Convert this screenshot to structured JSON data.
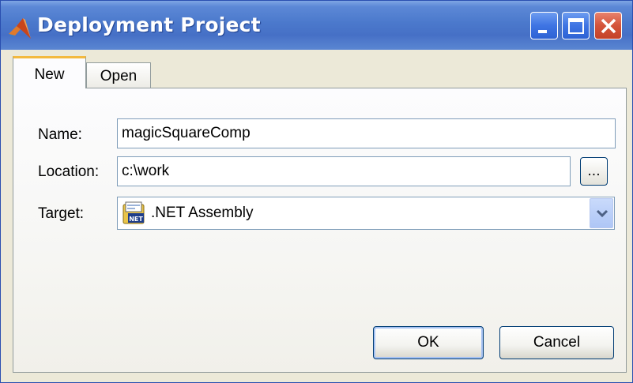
{
  "window": {
    "title": "Deployment Project"
  },
  "tabs": [
    {
      "label": "New",
      "active": true
    },
    {
      "label": "Open",
      "active": false
    }
  ],
  "form": {
    "name_label": "Name:",
    "name_value": "magicSquareComp",
    "location_label": "Location:",
    "location_value": "c:\\work",
    "browse_label": "...",
    "target_label": "Target:",
    "target_value": ".NET Assembly",
    "target_icon": "dotnet-assembly-icon"
  },
  "buttons": {
    "ok_label": "OK",
    "cancel_label": "Cancel"
  },
  "colors": {
    "titlebar": "#4b79cc",
    "close_button": "#d4533a",
    "active_tab_accent": "#f3b93f",
    "window_background": "#ece9d8"
  }
}
